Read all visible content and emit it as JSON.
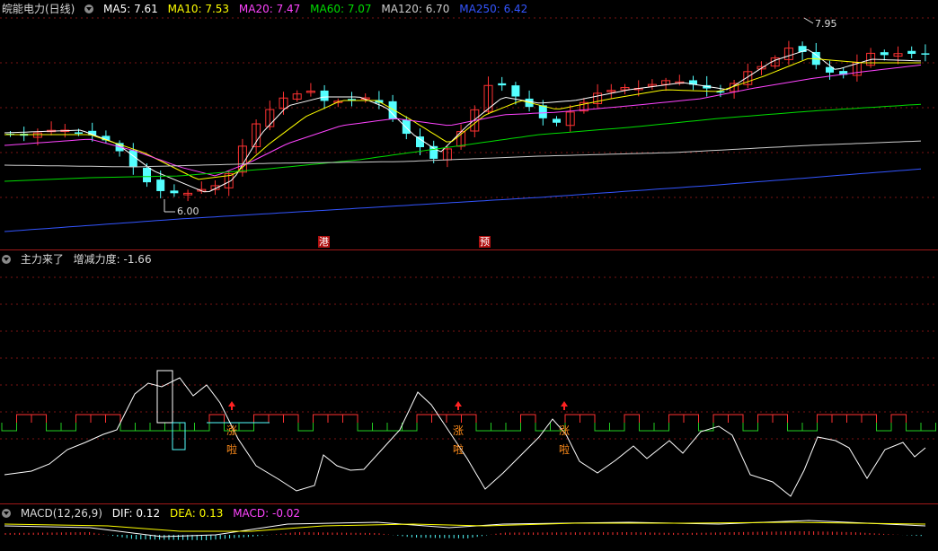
{
  "main": {
    "title": "皖能电力(日线)",
    "ma5_label": "MA5: 7.61",
    "ma10_label": "MA10: 7.53",
    "ma20_label": "MA20: 7.47",
    "ma60_label": "MA60: 7.07",
    "ma120_label": "MA120: 6.70",
    "ma250_label": "MA250: 6.42",
    "high_label": "7.95",
    "low_label": "6.00",
    "marker_1": "港",
    "marker_2": "预"
  },
  "indicator": {
    "title": "主力来了",
    "value_label": "增减力度: -1.66",
    "signal_char_1": "涨",
    "signal_char_2": "啦"
  },
  "macd": {
    "title": "MACD(12,26,9)",
    "dif_label": "DIF: 0.12",
    "dea_label": "DEA: 0.13",
    "macd_label": "MACD: -0.02"
  },
  "colors": {
    "ma5": "#ffffff",
    "ma10": "#ffff00",
    "ma20": "#ff44ff",
    "ma60": "#00dd00",
    "ma120": "#cccccc",
    "ma250": "#3355ff",
    "up": "#ff3232",
    "down": "#54ffff",
    "grid": "#7a1414"
  }
}
